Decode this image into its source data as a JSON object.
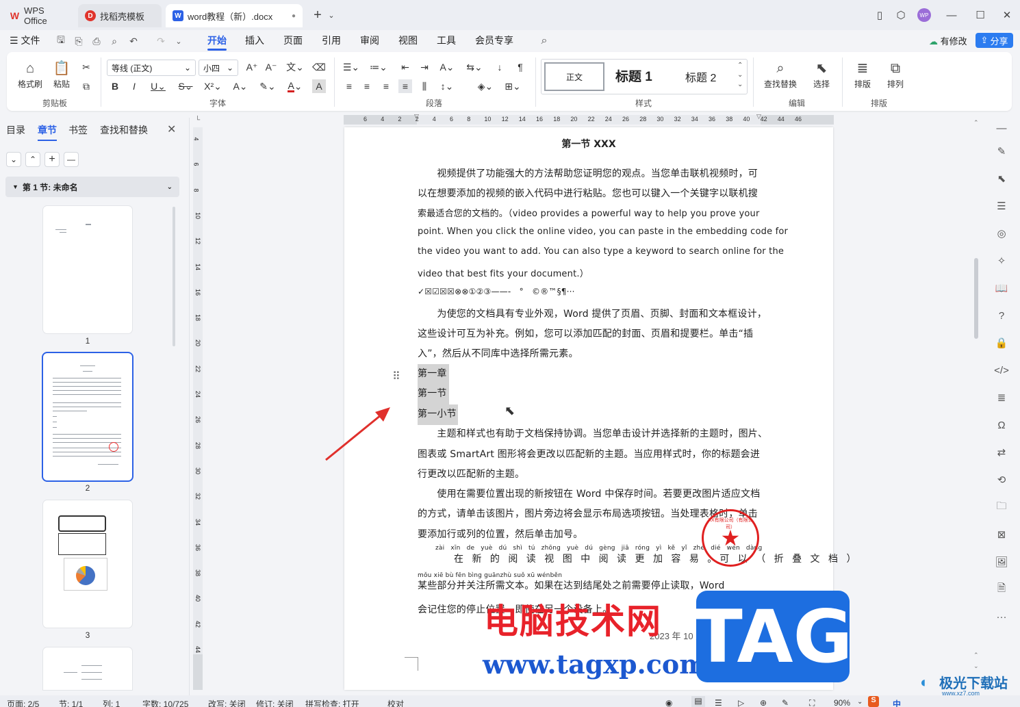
{
  "titlebar": {
    "tabs": [
      {
        "label": "WPS Office",
        "badge": "W",
        "color": "#e0342c"
      },
      {
        "label": "找稻壳模板",
        "badge": "D",
        "color": "#e0342c"
      },
      {
        "label": "word教程（新）.docx",
        "badge": "W",
        "color": "#2c61e6"
      }
    ],
    "avatar": "WP"
  },
  "menubar": {
    "file": "文件",
    "items": [
      "开始",
      "插入",
      "页面",
      "引用",
      "审阅",
      "视图",
      "工具",
      "会员专享"
    ],
    "revision": "有修改",
    "share": "分享"
  },
  "ribbon": {
    "format_painter": "格式刷",
    "paste": "粘贴",
    "clipboard_label": "剪贴板",
    "font_name": "等线 (正文)",
    "font_size": "小四",
    "font_label": "字体",
    "paragraph_label": "段落",
    "styles": {
      "normal": "正文",
      "h1": "标题 1",
      "h2": "标题 2"
    },
    "styles_label": "样式",
    "find_replace": "查找替换",
    "select": "选择",
    "edit_label": "编辑",
    "layout": "排版",
    "arrange": "排列",
    "layout_label": "排版"
  },
  "leftpanel": {
    "tabs": [
      "目录",
      "章节",
      "书签",
      "查找和替换"
    ],
    "section_title": "第 1 节: 未命名",
    "page_numbers": [
      "1",
      "2",
      "3"
    ]
  },
  "ruler": {
    "h_ticks": [
      "6",
      "4",
      "2",
      "2",
      "4",
      "6",
      "8",
      "10",
      "12",
      "14",
      "16",
      "18",
      "20",
      "22",
      "24",
      "26",
      "28",
      "30",
      "32",
      "34",
      "36",
      "38",
      "40",
      "42",
      "44",
      "46"
    ],
    "v_ticks": [
      "4",
      "6",
      "8",
      "10",
      "12",
      "14",
      "16",
      "18",
      "20",
      "22",
      "24",
      "26",
      "28",
      "30",
      "32",
      "34",
      "36",
      "38",
      "40",
      "42",
      "44",
      "46"
    ]
  },
  "document": {
    "heading": "第一节 XXX",
    "lines": [
      "　　视频提供了功能强大的方法帮助您证明您的观点。当您单击联机视频时，可",
      "以在想要添加的视频的嵌入代码中进行粘贴。您也可以键入一个关键字以联机搜",
      "索最适合您的文档的。（video provides a powerful way to help you prove your",
      "point. When you click the online video, you can paste in the embedding code for",
      "the video you want to add. You can also type a keyword to search online for the",
      "video that best fits your document.）",
      "✓☒☑☒☒⊗⊗①②③——-　°　©®™§¶···",
      "　　为使您的文档具有专业外观，Word 提供了页眉、页脚、封面和文本框设计，",
      "这些设计可互为补充。例如，您可以添加匹配的封面、页眉和提要栏。单击“插",
      "入”，然后从不同库中选择所需元素。"
    ],
    "selected": [
      "第一章",
      "第一节",
      "第一小节"
    ],
    "lines2": [
      "　　主题和样式也有助于文档保持协调。当您单击设计并选择新的主题时，图片、",
      "图表或 SmartArt 图形将会更改以匹配新的主题。当应用样式时，你的标题会进",
      "行更改以匹配新的主题。",
      "　　使用在需要位置出现的新按钮在 Word 中保存时间。若要更改图片适应文档",
      "的方式，请单击该图片，图片旁边将会显示布局选项按钮。当处理表格时，单击",
      "要添加行或列的位置，然后单击加号。"
    ],
    "pinyin1": "zài xīn de yuè dú shì tú zhōng yuè dú gèng jiā róng yì kě yǐ zhé dié wén dàng",
    "ruby1": "在 新 的 阅 读 视 图 中 阅 读 更 加 容 易 。可 以 （ 折 叠 文 档 ）",
    "pinyin2": "mǒu xiē bù fēn bìng guānzhù suǒ xū wénběn",
    "ruby2": "某些部分并关注所需文本。如果在达到结尾处之前需要停止读取，Word",
    "line_last": "会记住您的停止位置 - 即使在另一个设备上。",
    "date": "2023 年 10 月 17 日星期二",
    "stamp_text": "XX有限公司（有限公司）"
  },
  "watermark": {
    "cn": "电脑技术网",
    "url": "www.tagxp.com",
    "tag": "TAG",
    "corner": "极光下载站",
    "corner_url": "www.xz7.com"
  },
  "statusbar": {
    "page": "页面: 2/5",
    "section": "节: 1/1",
    "column": "列: 1",
    "words": "字数: 10/725",
    "revise": "改写: 关闭",
    "track": "修订: 关闭",
    "spell": "拼写检查: 打开",
    "proof": "校对",
    "zoom": "90%"
  }
}
